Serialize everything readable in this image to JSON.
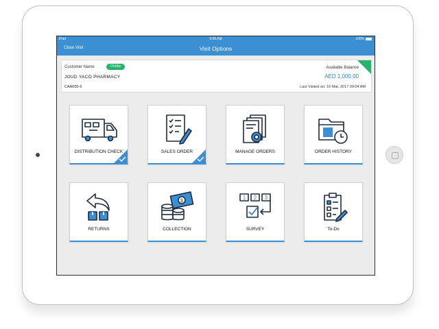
{
  "status_bar": {
    "device": "iPad",
    "time": "9:08 AM",
    "battery": "100%"
  },
  "nav": {
    "close_label": "Close Visit",
    "title": "Visit Options"
  },
  "customer": {
    "label": "Customer Name",
    "badge": "OnSite",
    "name": "JOUD YACO PHARMACY",
    "code": "CAA005-6",
    "balance_label": "Available Balance",
    "balance_value": "AED 1,000.00",
    "last_visited_label": "Last Visited on:",
    "last_visited_value": "16 Mar, 2017 09:04 AM"
  },
  "tiles": [
    {
      "label": "DISTRIBUTION CHECK",
      "icon": "delivery-truck-icon",
      "completed": true
    },
    {
      "label": "SALES ORDER",
      "icon": "order-checklist-icon",
      "completed": true
    },
    {
      "label": "MANAGE ORDERS",
      "icon": "documents-settings-icon",
      "completed": false
    },
    {
      "label": "ORDER HISTORY",
      "icon": "folder-clock-icon",
      "completed": false
    },
    {
      "label": "RETURNS",
      "icon": "return-arrow-boxes-icon",
      "completed": false
    },
    {
      "label": "COLLECTION",
      "icon": "coins-money-icon",
      "completed": false
    },
    {
      "label": "SURVEY",
      "icon": "survey-steps-icon",
      "completed": false
    },
    {
      "label": "To-Do",
      "icon": "todo-clipboard-icon",
      "completed": false
    }
  ],
  "colors": {
    "accent": "#3d8fd4",
    "onsite": "#27b36b",
    "balance": "#2f80c9"
  }
}
